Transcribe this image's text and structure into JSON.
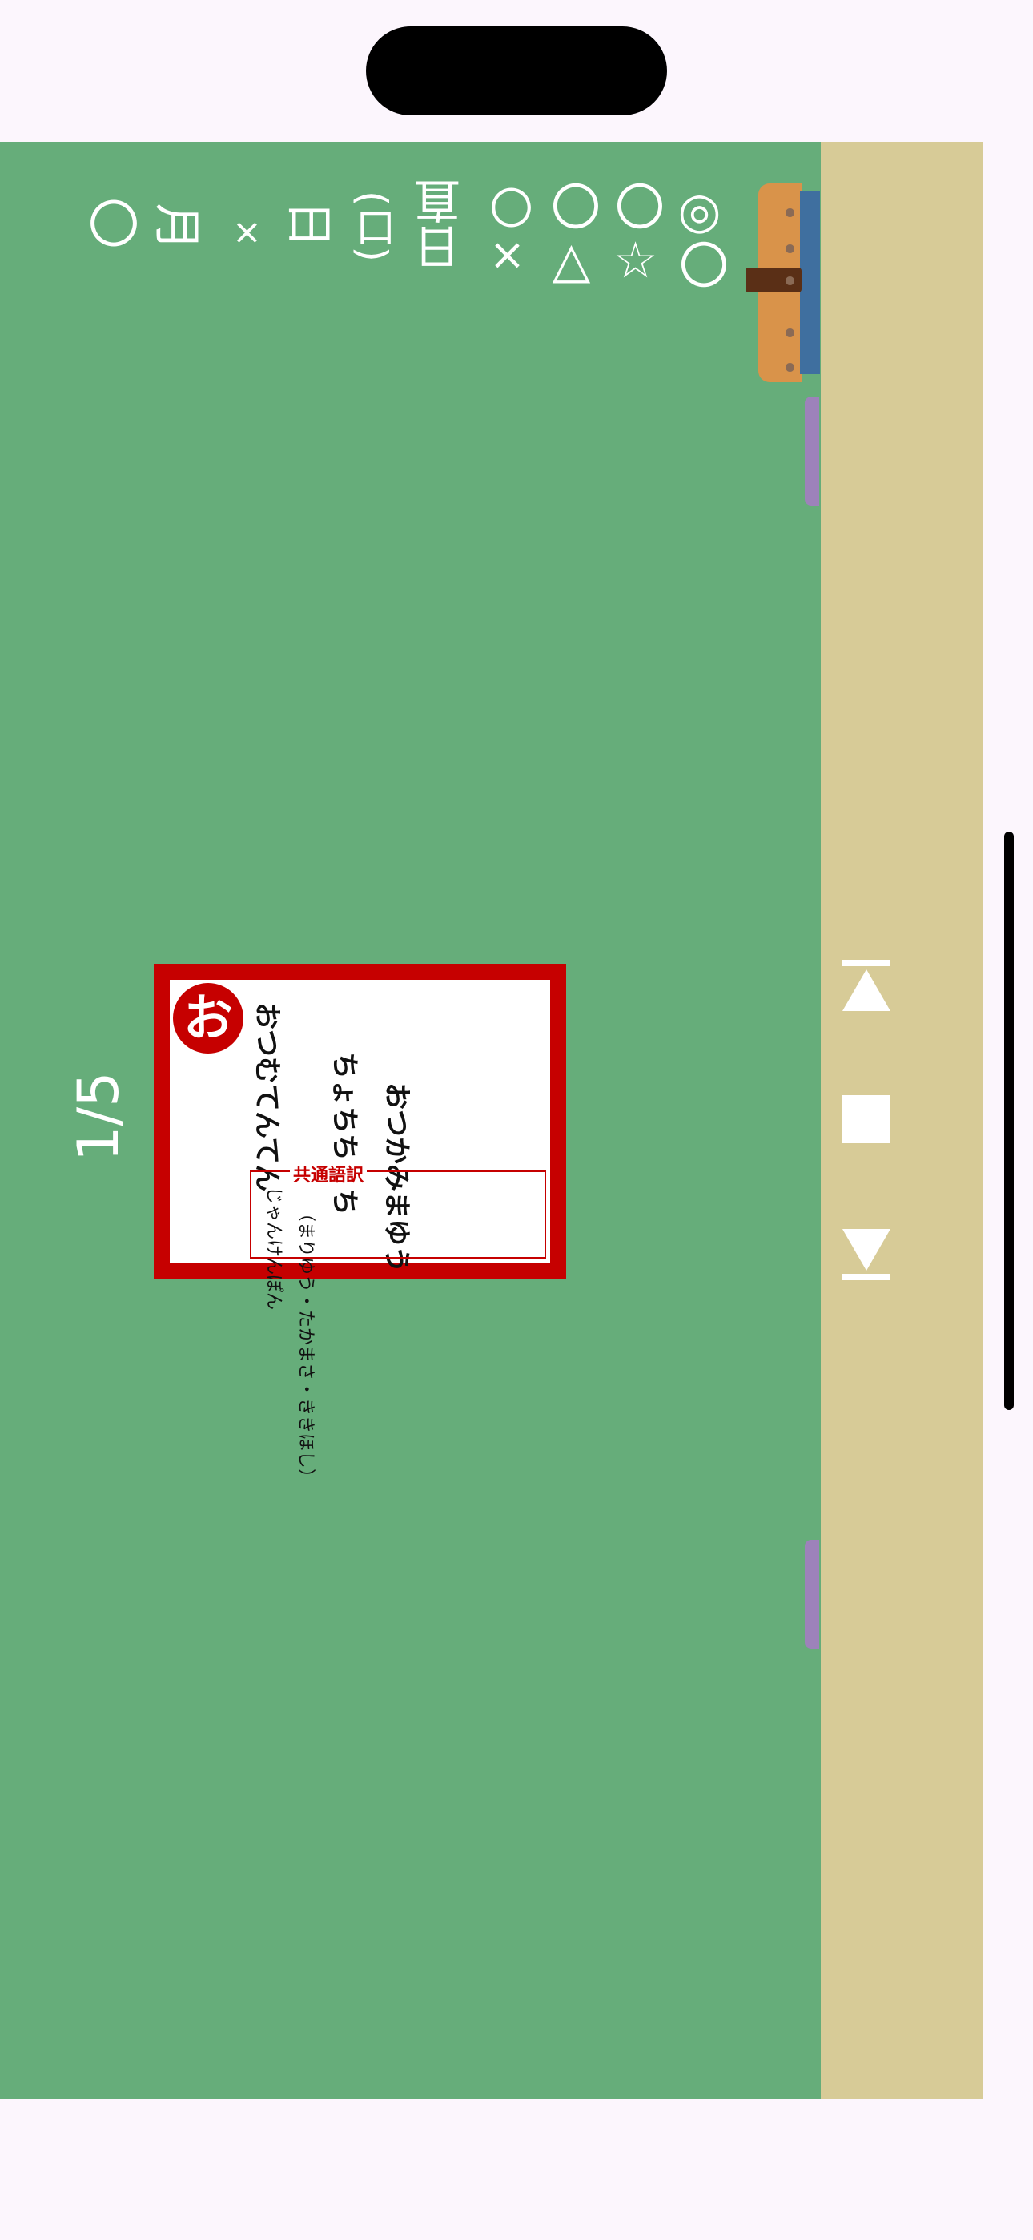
{
  "status_bar": {},
  "chalkboard": {
    "date_line": {
      "month_blank": "〇",
      "month_kanji": "月",
      "times": "×",
      "day_kanji": "日",
      "weekday": "(口)",
      "duty_kanji": "日直",
      "marks": [
        "〇×",
        "〇△",
        "〇☆",
        "◎〇"
      ]
    },
    "page_indicator": "1/5"
  },
  "card": {
    "badge": "お",
    "lines": [
      "おつむてんてん",
      "ちょちちょち",
      "おつかみまゆう"
    ],
    "subheader": "共通語訳",
    "sub_lines": [
      "じゃんけんぽん",
      "（まりゆう・たかまさ・ききほし）"
    ]
  },
  "controls": {
    "prev_label": "",
    "stop_label": "",
    "next_label": ""
  },
  "colors": {
    "board": "#66ad7a",
    "rail": "#d7cb97",
    "card_red": "#c60000",
    "background": "#fcf6fd"
  }
}
